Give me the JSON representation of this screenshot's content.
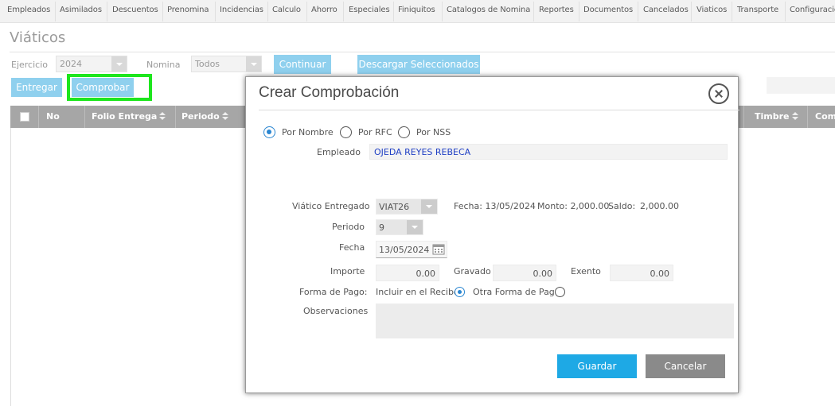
{
  "nav": {
    "items": [
      "Empleados",
      "Asimilados",
      "Descuentos",
      "Prenomina",
      "Incidencias",
      "Calculo",
      "Ahorro",
      "Especiales",
      "Finiquitos",
      "Catalogos de Nomina",
      "Reportes",
      "Documentos",
      "Cancelados",
      "Viaticos",
      "Transporte",
      "Configuracio"
    ]
  },
  "page": {
    "title": "Viáticos"
  },
  "filters": {
    "ejercicio_label": "Ejercicio",
    "ejercicio_value": "2024",
    "nomina_label": "Nomina",
    "nomina_value": "Todos",
    "continuar_label": "Continuar",
    "descargar_label": "Descargar Seleccionados"
  },
  "actions": {
    "entregar_label": "Entregar",
    "comprobar_label": "Comprobar"
  },
  "table": {
    "headers": [
      "No",
      "Folio Entrega",
      "Periodo",
      "Timbre",
      "Com"
    ]
  },
  "modal": {
    "title": "Crear Comprobación",
    "search_by": {
      "options": [
        "Por Nombre",
        "Por RFC",
        "Por NSS"
      ],
      "selected": "Por Nombre"
    },
    "empleado_label": "Empleado",
    "empleado_value": "OJEDA REYES REBECA",
    "viatico_label": "Viático Entregado",
    "viatico_value": "VIAT26",
    "fecha_info": "Fecha: 13/05/2024",
    "monto_info": "Monto: 2,000.00",
    "saldo_label": "Saldo:",
    "saldo_value": "2,000.00",
    "periodo_label": "Periodo",
    "periodo_value": "9",
    "fecha_label": "Fecha",
    "fecha_value": "13/05/2024",
    "importe_label": "Importe",
    "importe_value": "0.00",
    "gravado_label": "Gravado",
    "gravado_value": "0.00",
    "exento_label": "Exento",
    "exento_value": "0.00",
    "forma_pago_label": "Forma de Pago:",
    "forma_pago_options": [
      "Incluir en el Recibo",
      "Otra Forma de Pago"
    ],
    "forma_pago_selected": "Incluir en el Recibo",
    "observaciones_label": "Observaciones",
    "observaciones_value": "",
    "guardar_label": "Guardar",
    "cancelar_label": "Cancelar"
  },
  "colors": {
    "accent_light": "#8fd0ee",
    "primary": "#1ea9e5",
    "cancel": "#8a8a8a",
    "highlight": "#1ee61e",
    "radio": "#2a86d1",
    "employee_text": "#1f3fc4"
  }
}
